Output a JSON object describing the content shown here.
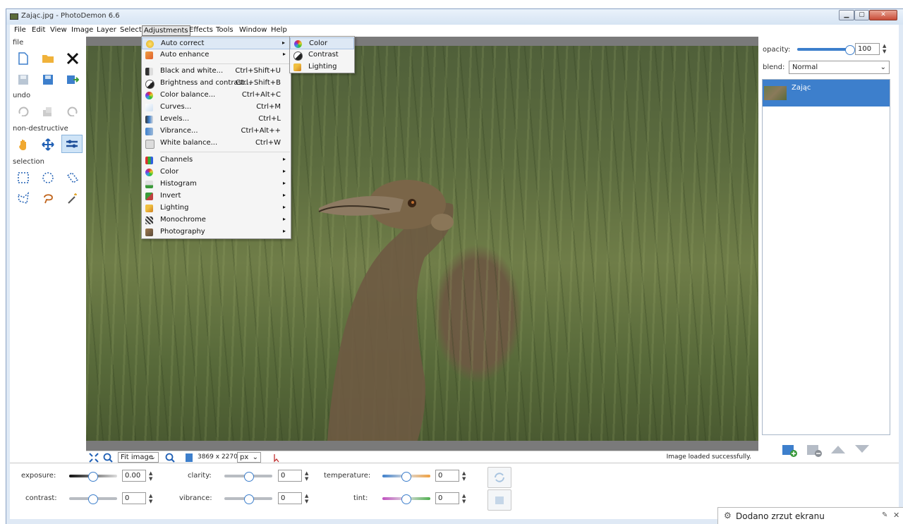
{
  "window": {
    "title": "Zając.jpg  -  PhotoDemon 6.6",
    "minimize": "▁",
    "maximize": "▢",
    "close": "✕"
  },
  "menubar": [
    "File",
    "Edit",
    "View",
    "Image",
    "Layer",
    "Select",
    "Adjustments",
    "Effects",
    "Tools",
    "Window",
    "Help"
  ],
  "toolbox": {
    "file_label": "file",
    "undo_label": "undo",
    "nondestructive_label": "non-destructive",
    "selection_label": "selection"
  },
  "adjustments_menu": {
    "group1": [
      {
        "label": "Auto correct",
        "icon": "bulb-icon",
        "arrow": "▸"
      },
      {
        "label": "Auto enhance",
        "icon": "enhance-icon",
        "arrow": "▸"
      }
    ],
    "group2": [
      {
        "label": "Black and white...",
        "shortcut": "Ctrl+Shift+U",
        "icon": "bw-icon"
      },
      {
        "label": "Brightness and contrast...",
        "shortcut": "Ctrl+Shift+B",
        "icon": "contrast-icon"
      },
      {
        "label": "Color balance...",
        "shortcut": "Ctrl+Alt+C",
        "icon": "colorwheel-icon"
      },
      {
        "label": "Curves...",
        "shortcut": "Ctrl+M",
        "icon": "curves-icon"
      },
      {
        "label": "Levels...",
        "shortcut": "Ctrl+L",
        "icon": "levels-icon"
      },
      {
        "label": "Vibrance...",
        "shortcut": "Ctrl+Alt++",
        "icon": "vibrance-icon"
      },
      {
        "label": "White balance...",
        "shortcut": "Ctrl+W",
        "icon": "whitebalance-icon"
      }
    ],
    "group3": [
      {
        "label": "Channels",
        "icon": "channels-icon",
        "arrow": "▸"
      },
      {
        "label": "Color",
        "icon": "color-icon",
        "arrow": "▸"
      },
      {
        "label": "Histogram",
        "icon": "histogram-icon",
        "arrow": "▸"
      },
      {
        "label": "Invert",
        "icon": "invert-icon",
        "arrow": "▸"
      },
      {
        "label": "Lighting",
        "icon": "lighting-icon",
        "arrow": "▸"
      },
      {
        "label": "Monochrome",
        "icon": "monochrome-icon",
        "arrow": "▸"
      },
      {
        "label": "Photography",
        "icon": "photography-icon",
        "arrow": "▸"
      }
    ]
  },
  "auto_correct_submenu": [
    {
      "label": "Color",
      "icon": "colorwheel-icon"
    },
    {
      "label": "Contrast",
      "icon": "contrast-icon"
    },
    {
      "label": "Lighting",
      "icon": "lighting-icon"
    }
  ],
  "statusbar": {
    "zoom_select": "Fit image",
    "dimensions": "3869 x 2270",
    "unit_select": "px",
    "message": "Image loaded successfully."
  },
  "rightpanel": {
    "opacity_label": "opacity:",
    "opacity_value": "100",
    "opacity_level": 1.0,
    "blend_label": "blend:",
    "blend_value": "Normal",
    "layer_name": "Zając"
  },
  "adjust_panel": {
    "exposure_label": "exposure:",
    "exposure_value": "0.00",
    "contrast_label": "contrast:",
    "contrast_value": "0",
    "clarity_label": "clarity:",
    "clarity_value": "0",
    "vibrance_label": "vibrance:",
    "vibrance_value": "0",
    "temperature_label": "temperature:",
    "temperature_value": "0",
    "tint_label": "tint:",
    "tint_value": "0"
  },
  "notification": {
    "text": "Dodano zrzut ekranu"
  },
  "colors": {
    "accent": "#3d7fcc",
    "menu_highlight": "#dde8f5",
    "canvas_bg": "#7a7a7a"
  }
}
